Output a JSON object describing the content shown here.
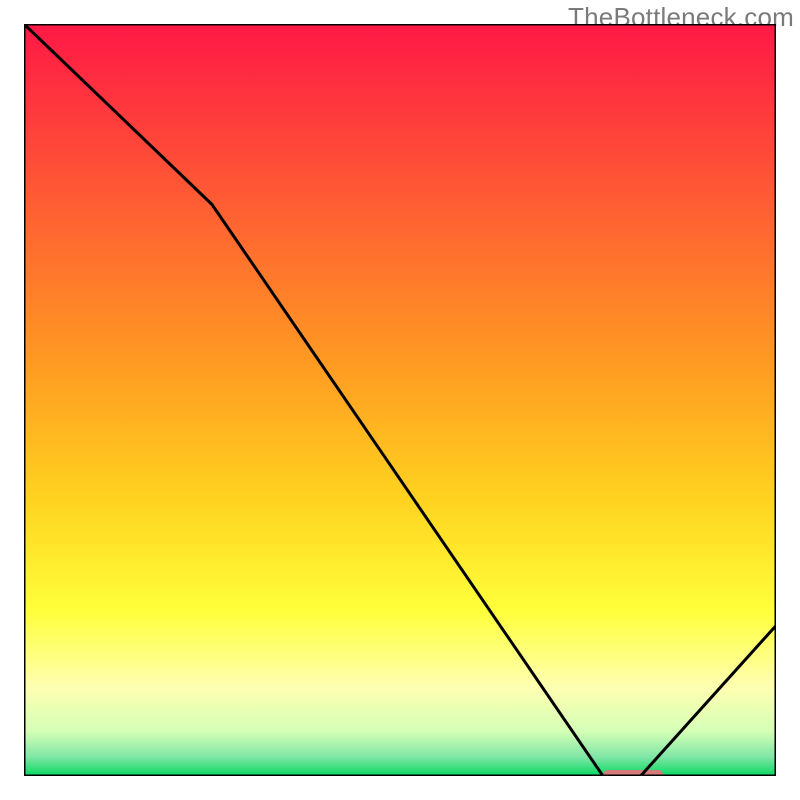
{
  "watermark": "TheBottleneck.com",
  "chart_data": {
    "type": "line",
    "title": "",
    "xlabel": "",
    "ylabel": "",
    "xlim": [
      0,
      100
    ],
    "ylim": [
      0,
      100
    ],
    "x": [
      0,
      25,
      77,
      82,
      100
    ],
    "values": [
      100,
      76,
      0,
      0,
      20
    ],
    "marker": {
      "x_start": 77,
      "x_end": 85,
      "y": 0,
      "color": "#d47a7a"
    },
    "gradient": {
      "direction": "vertical",
      "stops": [
        {
          "pos": 0.0,
          "color": "#ff1846"
        },
        {
          "pos": 0.45,
          "color": "#ff9a22"
        },
        {
          "pos": 0.63,
          "color": "#ffd21f"
        },
        {
          "pos": 0.78,
          "color": "#ffff3a"
        },
        {
          "pos": 0.88,
          "color": "#ffffb0"
        },
        {
          "pos": 0.94,
          "color": "#d6ffb6"
        },
        {
          "pos": 0.975,
          "color": "#7fe6a6"
        },
        {
          "pos": 1.0,
          "color": "#06d85f"
        }
      ]
    },
    "border": {
      "color": "#000000",
      "width": 3
    },
    "curve_style": {
      "color": "#000000",
      "width": 3
    }
  }
}
